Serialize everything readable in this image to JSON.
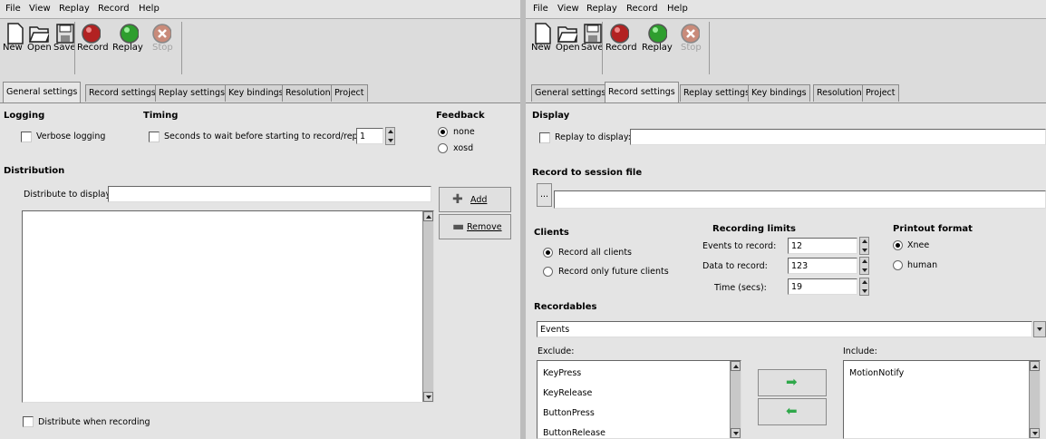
{
  "menu": [
    "File",
    "View",
    "Replay",
    "Record",
    "Help"
  ],
  "toolbar": {
    "new": "New",
    "open": "Open",
    "save": "Save",
    "record": "Record",
    "replay": "Replay",
    "stop": "Stop"
  },
  "tabs": [
    "General settings",
    "Record settings",
    "Replay settings",
    "Key bindings",
    "Resolution",
    "Project"
  ],
  "left": {
    "active_tab": "General settings",
    "logging": {
      "title": "Logging",
      "verbose_label": "Verbose logging"
    },
    "timing": {
      "title": "Timing",
      "wait_label": "Seconds to wait before starting to record/replay",
      "wait_value": "1"
    },
    "feedback": {
      "title": "Feedback",
      "options": [
        "none",
        "xosd"
      ],
      "selected": "none"
    },
    "distribution": {
      "title": "Distribution",
      "display_label": "Distribute to display:",
      "display_value": "",
      "add_label": "Add",
      "remove_label": "Remove",
      "when_recording_label": "Distribute when recording"
    }
  },
  "right": {
    "active_tab": "Record settings",
    "display": {
      "title": "Display",
      "replay_label": "Replay to display:",
      "replay_value": ""
    },
    "session": {
      "title": "Record to session file",
      "browse_label": "...",
      "file_value": ""
    },
    "clients": {
      "title": "Clients",
      "options": [
        "Record all clients",
        "Record only future clients"
      ],
      "selected": "Record all clients"
    },
    "limits": {
      "title": "Recording limits",
      "events_label": "Events to record:",
      "events_value": "12",
      "data_label": "Data to record:",
      "data_value": "123",
      "time_label": "Time (secs):",
      "time_value": "19"
    },
    "printout": {
      "title": "Printout format",
      "options": [
        "Xnee",
        "human"
      ],
      "selected": "Xnee"
    },
    "recordables": {
      "title": "Recordables",
      "selected": "Events",
      "exclude_label": "Exclude:",
      "include_label": "Include:",
      "exclude_items": [
        "KeyPress",
        "KeyRelease",
        "ButtonPress",
        "ButtonRelease"
      ],
      "include_items": [
        "MotionNotify"
      ]
    }
  },
  "colors": {
    "record": "#b22222",
    "replay": "#2e9e2e",
    "stop": "#c98b7a",
    "arrows": "#2fa84a"
  }
}
